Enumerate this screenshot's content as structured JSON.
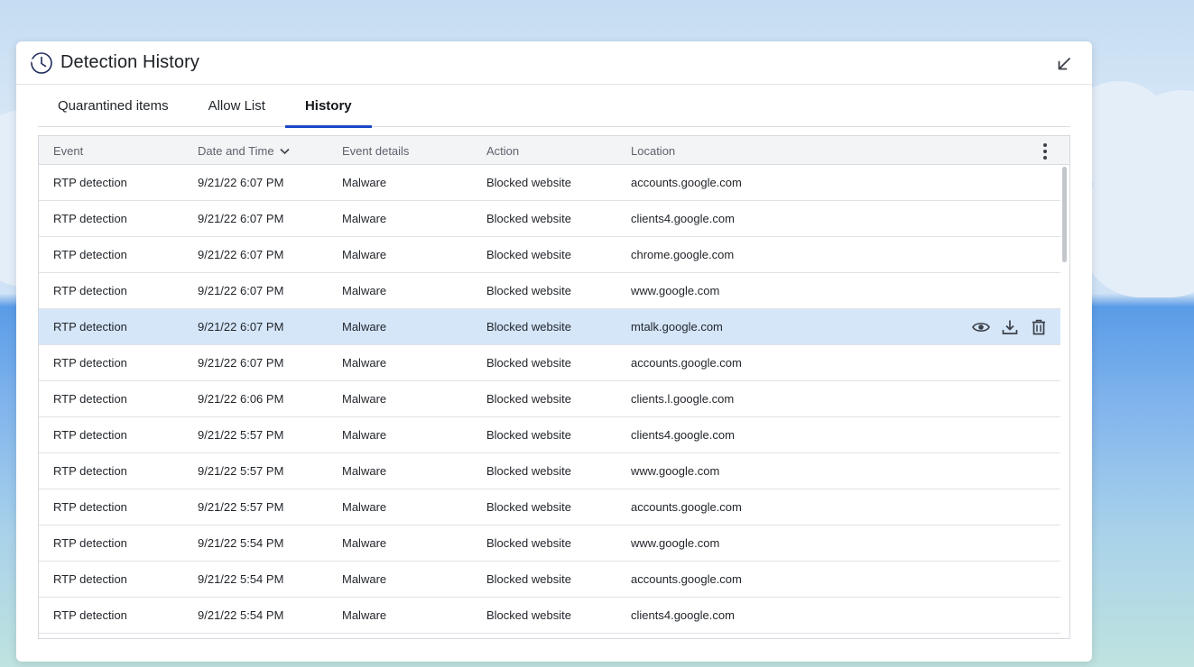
{
  "window": {
    "title": "Detection History",
    "icon": "clock-icon",
    "collapse_icon": "collapse-arrow-icon"
  },
  "tabs": [
    {
      "label": "Quarantined items",
      "active": false
    },
    {
      "label": "Allow List",
      "active": false
    },
    {
      "label": "History",
      "active": true
    }
  ],
  "table": {
    "columns": [
      "Event",
      "Date and Time",
      "Event details",
      "Action",
      "Location"
    ],
    "sort_column": "Date and Time",
    "sort_direction": "descending",
    "rows": [
      {
        "event": "RTP detection",
        "date": "9/21/22 6:07 PM",
        "details": "Malware",
        "action": "Blocked website",
        "location": "accounts.google.com"
      },
      {
        "event": "RTP detection",
        "date": "9/21/22 6:07 PM",
        "details": "Malware",
        "action": "Blocked website",
        "location": "clients4.google.com"
      },
      {
        "event": "RTP detection",
        "date": "9/21/22 6:07 PM",
        "details": "Malware",
        "action": "Blocked website",
        "location": "chrome.google.com"
      },
      {
        "event": "RTP detection",
        "date": "9/21/22 6:07 PM",
        "details": "Malware",
        "action": "Blocked website",
        "location": "www.google.com"
      },
      {
        "event": "RTP detection",
        "date": "9/21/22 6:07 PM",
        "details": "Malware",
        "action": "Blocked website",
        "location": "mtalk.google.com",
        "highlighted": true
      },
      {
        "event": "RTP detection",
        "date": "9/21/22 6:07 PM",
        "details": "Malware",
        "action": "Blocked website",
        "location": "accounts.google.com"
      },
      {
        "event": "RTP detection",
        "date": "9/21/22 6:06 PM",
        "details": "Malware",
        "action": "Blocked website",
        "location": "clients.l.google.com"
      },
      {
        "event": "RTP detection",
        "date": "9/21/22 5:57 PM",
        "details": "Malware",
        "action": "Blocked website",
        "location": "clients4.google.com"
      },
      {
        "event": "RTP detection",
        "date": "9/21/22 5:57 PM",
        "details": "Malware",
        "action": "Blocked website",
        "location": "www.google.com"
      },
      {
        "event": "RTP detection",
        "date": "9/21/22 5:57 PM",
        "details": "Malware",
        "action": "Blocked website",
        "location": "accounts.google.com"
      },
      {
        "event": "RTP detection",
        "date": "9/21/22 5:54 PM",
        "details": "Malware",
        "action": "Blocked website",
        "location": "www.google.com"
      },
      {
        "event": "RTP detection",
        "date": "9/21/22 5:54 PM",
        "details": "Malware",
        "action": "Blocked website",
        "location": "accounts.google.com"
      },
      {
        "event": "RTP detection",
        "date": "9/21/22 5:54 PM",
        "details": "Malware",
        "action": "Blocked website",
        "location": "clients4.google.com"
      }
    ],
    "row_action_icons": [
      "eye-icon",
      "download-icon",
      "trash-icon"
    ]
  },
  "colors": {
    "accent": "#1a47c7",
    "highlight_row": "#d5e6f9"
  }
}
